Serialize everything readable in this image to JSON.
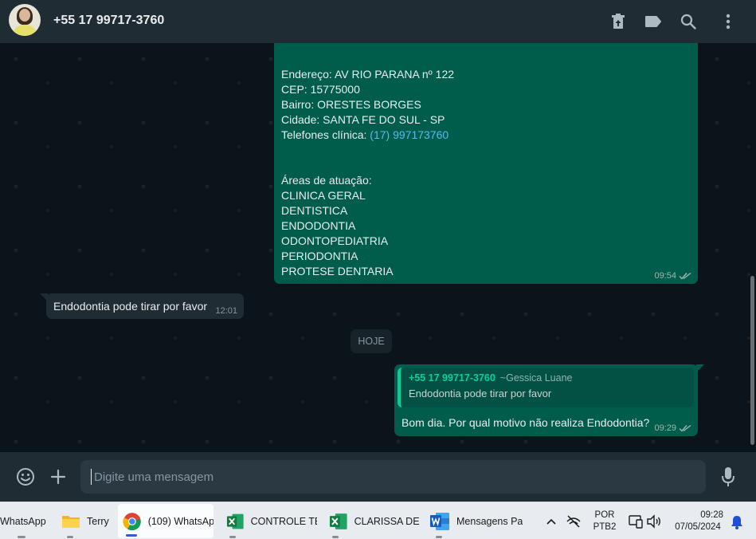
{
  "header": {
    "contact_name": "+55 17 99717-3760"
  },
  "chat": {
    "contact_card": {
      "lines": [
        "Endereço: AV RIO PARANA nº 122",
        "CEP: 15775000",
        "Bairro: ORESTES BORGES",
        "Cidade: SANTA FE DO SUL - SP"
      ],
      "phone_label": "Telefones clínica: ",
      "phone_link": "(17) 997173760",
      "areas_title": "Áreas de atuação:",
      "areas": [
        "CLINICA GERAL",
        "DENTISTICA",
        "ENDODONTIA",
        "ODONTOPEDIATRIA",
        "PERIODONTIA",
        "PROTESE DENTARIA"
      ],
      "time": "09:54"
    },
    "incoming": {
      "text": "Endodontia pode tirar por favor",
      "time": "12:01"
    },
    "day_divider": "HOJE",
    "reply": {
      "quote_author": "+55 17 99717-3760",
      "quote_author_name": "~Gessica Luane",
      "quote_text": "Endodontia pode tirar por favor",
      "text": "Bom dia. Por qual motivo não realiza Endodontia?",
      "time": "09:29"
    }
  },
  "composer": {
    "placeholder": "Digite uma mensagem"
  },
  "taskbar": {
    "items": [
      {
        "label": "WhatsApp"
      },
      {
        "label": "Terry"
      },
      {
        "label": "(109) WhatsAp"
      },
      {
        "label": "CONTROLE TE"
      },
      {
        "label": "CLARISSA DE A"
      },
      {
        "label": "Mensagens Pa"
      }
    ],
    "lang_top": "POR",
    "lang_bottom": "PTB2",
    "clock_time": "09:28",
    "clock_date": "07/05/2024"
  },
  "colors": {
    "outgoing_bubble": "#005c4b",
    "incoming_bubble": "#202c33",
    "accent": "#06cf9c",
    "link": "#53bdeb"
  }
}
